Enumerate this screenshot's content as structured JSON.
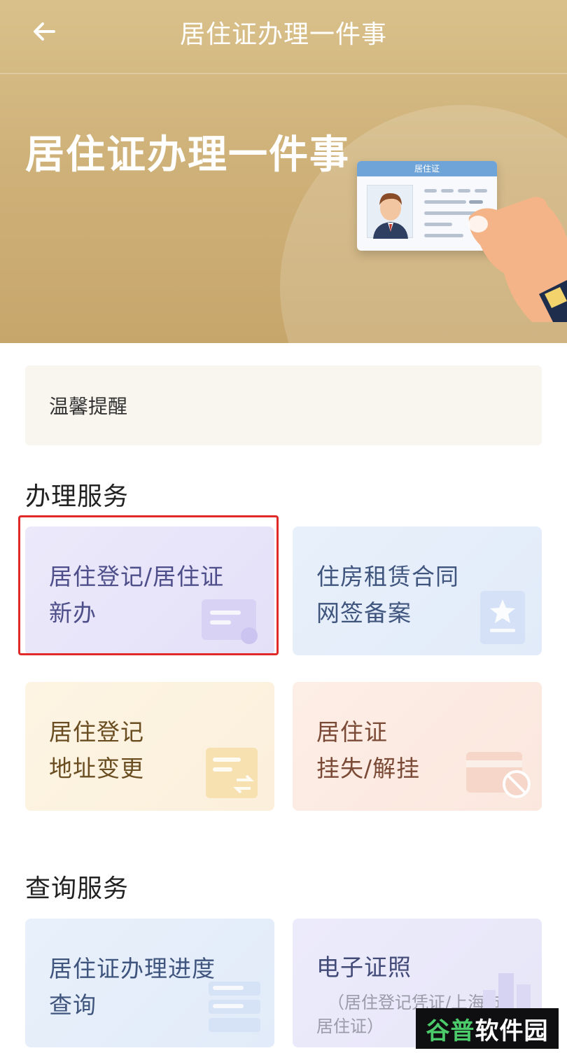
{
  "header": {
    "title": "居住证办理一件事",
    "banner_title": "居住证办理一件事",
    "card_label": "居住证"
  },
  "reminder": {
    "label": "温馨提醒"
  },
  "services": {
    "title": "办理服务",
    "items": [
      {
        "line1": "居住登记/居住证",
        "line2": "新办"
      },
      {
        "line1": "住房租赁合同",
        "line2": "网签备案"
      },
      {
        "line1": "居住登记",
        "line2": "地址变更"
      },
      {
        "line1": "居住证",
        "line2": "挂失/解挂"
      }
    ]
  },
  "queries": {
    "title": "查询服务",
    "items": [
      {
        "line1": "居住证办理进度",
        "line2": "查询"
      },
      {
        "line1": "电子证照",
        "sub1": "（居住登记凭证/上海市",
        "sub2": "居住证）"
      }
    ]
  },
  "watermark": {
    "part1": "谷普",
    "part2": "软件园"
  },
  "colors": {
    "banner": "#cfb27a",
    "highlight": "#e02a2a"
  },
  "icons": [
    "back-arrow-icon",
    "id-card-icon",
    "star-document-icon",
    "swap-document-icon",
    "blocked-card-icon",
    "list-document-icon",
    "city-icon"
  ]
}
